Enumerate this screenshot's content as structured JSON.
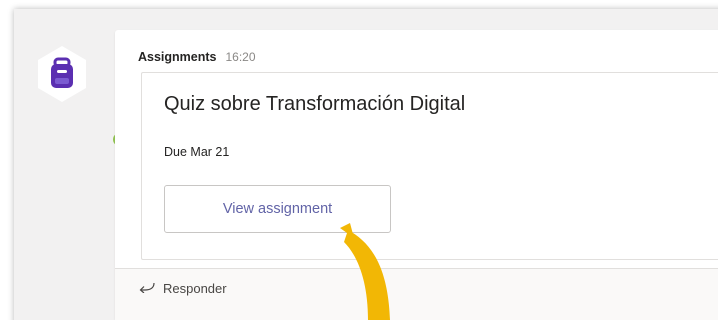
{
  "message": {
    "sender": "Assignments",
    "time": "16:20"
  },
  "card": {
    "title": "Quiz sobre Transformación Digital",
    "due": "Due Mar 21",
    "button_label": "View assignment"
  },
  "reply": {
    "label": "Responder"
  },
  "icons": {
    "avatar": "assignments-backpack-icon",
    "presence": "available-check-icon",
    "reply": "reply-arrow-icon",
    "pointer": "pointer-arrow"
  },
  "colors": {
    "accent": "#6264a7",
    "avatar_purple": "#5b2fb1",
    "presence_green": "#92c353",
    "pointer_yellow": "#f2b705"
  }
}
